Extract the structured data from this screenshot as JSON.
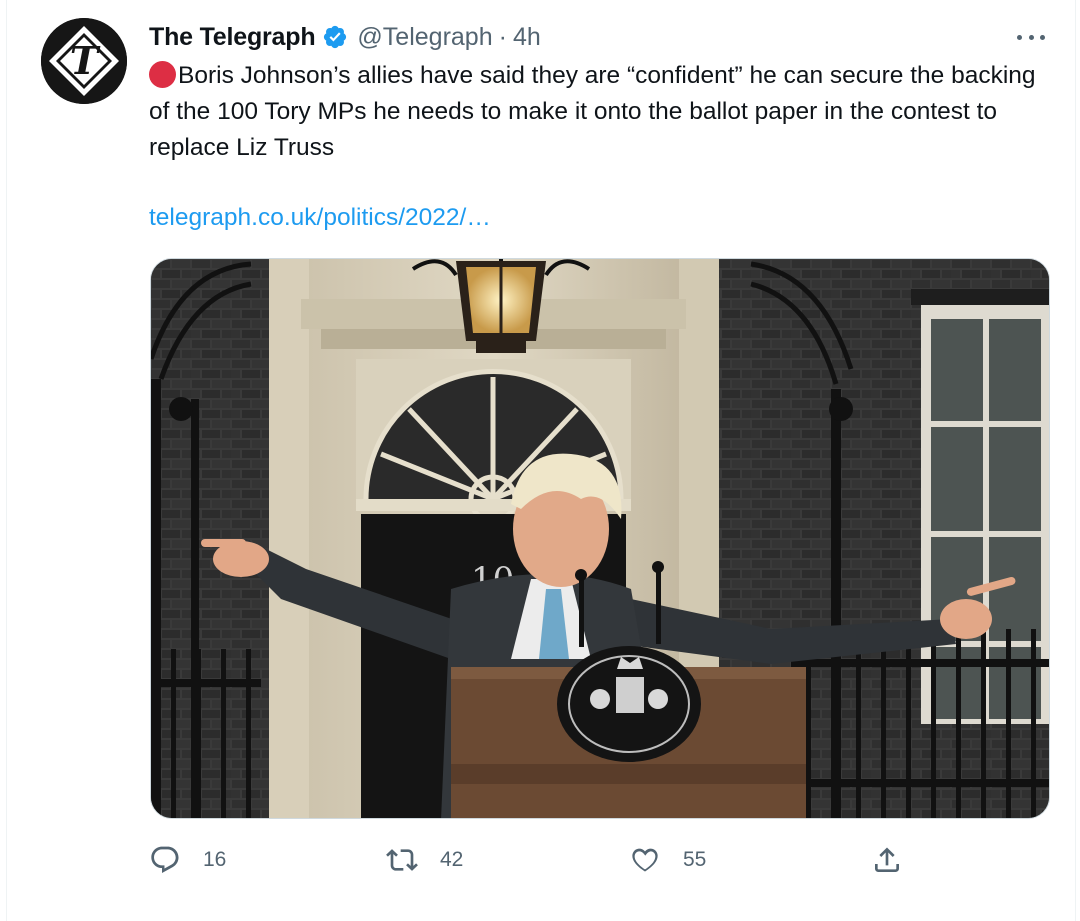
{
  "tweet": {
    "author": {
      "name": "The Telegraph",
      "handle": "@Telegraph",
      "verified": true,
      "avatar_letter": "T"
    },
    "separator": "·",
    "time": "4h",
    "text": "Boris Johnson’s allies have said they are “confident” he can secure the backing of the 100 Tory MPs he needs to make it onto the ballot paper in the contest to replace Liz Truss",
    "link": "telegraph.co.uk/politics/2022/…",
    "media": {
      "door_number": "10"
    },
    "stats": {
      "replies": "16",
      "retweets": "42",
      "likes": "55"
    }
  },
  "icons": {
    "more": "more-icon",
    "verified": "verified-badge-icon",
    "status": "red-circle-icon",
    "reply": "reply-icon",
    "retweet": "retweet-icon",
    "like": "heart-icon",
    "share": "share-icon"
  },
  "colors": {
    "link": "#1d9bf0",
    "verified": "#1d9bf0",
    "muted": "#536471",
    "red_circle": "#dd2e44"
  }
}
